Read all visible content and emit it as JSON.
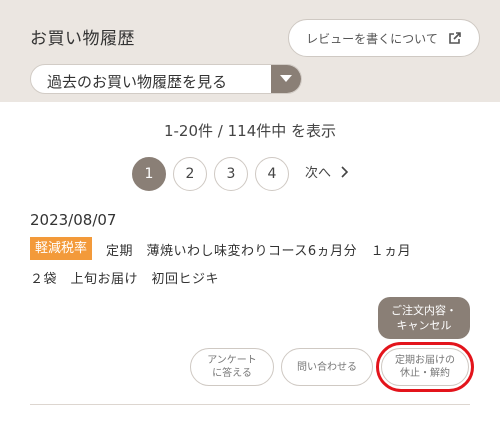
{
  "header": {
    "title": "お買い物履歴",
    "review_button_label": "レビューを書くについて",
    "review_icon": "external-link-icon"
  },
  "history_select": {
    "selected": "過去のお買い物履歴を見る",
    "arrow_icon": "caret-down-icon"
  },
  "results": {
    "count_text": "1-20件 / 114件中 を表示"
  },
  "pagination": {
    "pages": [
      "1",
      "2",
      "3",
      "4"
    ],
    "current_page": "1",
    "next_label": "次へ",
    "next_icon": "chevron-right-icon"
  },
  "order": {
    "date": "2023/08/07",
    "tax_badge": "軽減税率",
    "description_line1": "定期　薄焼いわし味変わりコース6ヵ月分　１ヵ月",
    "description_line2": "２袋　上旬お届け　初回ヒジキ",
    "cancel_button": [
      "ご注文内容・",
      "キャンセル"
    ],
    "survey_button": [
      "アンケート",
      "に答える"
    ],
    "contact_button": "問い合わせる",
    "suspend_button": [
      "定期お届けの",
      "休止・解約"
    ]
  },
  "colors": {
    "header_bg": "#ebe6e1",
    "accent_brown": "#8a7f76",
    "badge_orange": "#f39a3a",
    "highlight_red": "#e3141b"
  }
}
